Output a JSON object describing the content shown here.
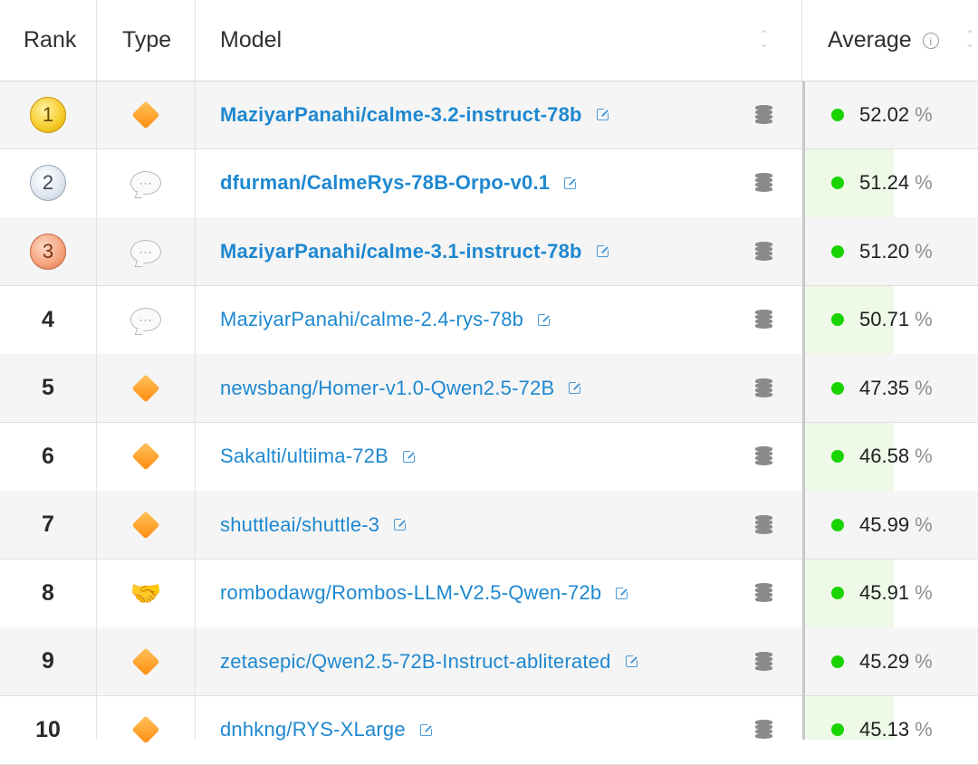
{
  "header": {
    "rank": "Rank",
    "type": "Type",
    "model": "Model",
    "average": "Average"
  },
  "colors": {
    "link": "#1e88d0",
    "status_dot": "#19d400",
    "alt_row": "#f5f5f5"
  },
  "rows": [
    {
      "rank": "1",
      "rank_style": "gold-medal",
      "type_icon": "diamond-icon",
      "model": "MaziyarPanahi/calme-3.2-instruct-78b",
      "bold": true,
      "average": "52.02",
      "unit": "%"
    },
    {
      "rank": "2",
      "rank_style": "silver-medal",
      "type_icon": "chat-icon",
      "chat_text": "···",
      "model": "dfurman/CalmeRys-78B-Orpo-v0.1",
      "bold": true,
      "average": "51.24",
      "unit": "%"
    },
    {
      "rank": "3",
      "rank_style": "bronze-medal",
      "type_icon": "chat-icon",
      "chat_text": "···",
      "model": "MaziyarPanahi/calme-3.1-instruct-78b",
      "bold": true,
      "average": "51.20",
      "unit": "%"
    },
    {
      "rank": "4",
      "type_icon": "chat-icon",
      "chat_text": "···",
      "model": "MaziyarPanahi/calme-2.4-rys-78b",
      "average": "50.71",
      "unit": "%"
    },
    {
      "rank": "5",
      "type_icon": "diamond-icon",
      "model": "newsbang/Homer-v1.0-Qwen2.5-72B",
      "average": "47.35",
      "unit": "%"
    },
    {
      "rank": "6",
      "type_icon": "diamond-icon",
      "model": "Sakalti/ultiima-72B",
      "average": "46.58",
      "unit": "%"
    },
    {
      "rank": "7",
      "type_icon": "diamond-icon",
      "model": "shuttleai/shuttle-3",
      "average": "45.99",
      "unit": "%"
    },
    {
      "rank": "8",
      "type_icon": "handshake-icon",
      "model": "rombodawg/Rombos-LLM-V2.5-Qwen-72b",
      "average": "45.91",
      "unit": "%"
    },
    {
      "rank": "9",
      "type_icon": "diamond-icon",
      "model": "zetasepic/Qwen2.5-72B-Instruct-abliterated",
      "average": "45.29",
      "unit": "%"
    },
    {
      "rank": "10",
      "type_icon": "diamond-icon",
      "model": "dnhkng/RYS-XLarge",
      "average": "45.13",
      "unit": "%"
    }
  ]
}
